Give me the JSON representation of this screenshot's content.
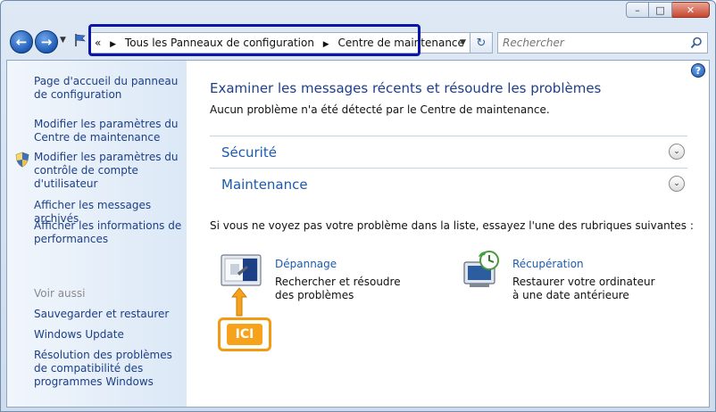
{
  "window": {
    "caption": {
      "minimize": "–",
      "maximize": "□",
      "close": "✕"
    }
  },
  "nav": {
    "back_glyph": "←",
    "forward_glyph": "→",
    "dropdown_glyph": "▼",
    "breadcrumb_prefix": "«",
    "breadcrumb": [
      "Tous les Panneaux de configuration",
      "Centre de maintenance"
    ],
    "breadcrumb_sep": "▶",
    "refresh_glyph": "↻",
    "search_placeholder": "Rechercher"
  },
  "sidebar": {
    "links": [
      "Page d'accueil du panneau de configuration",
      "Modifier les paramètres du Centre de maintenance",
      "Modifier les paramètres du contrôle de compte d'utilisateur",
      "Afficher les messages archivés",
      "Afficher les informations de performances"
    ],
    "see_also_label": "Voir aussi",
    "see_also": [
      "Sauvegarder et restaurer",
      "Windows Update",
      "Résolution des problèmes de compatibilité des programmes Windows"
    ]
  },
  "main": {
    "help_glyph": "?",
    "title": "Examiner les messages récents et résoudre les problèmes",
    "subtitle": "Aucun problème n'a été détecté par le Centre de maintenance.",
    "sections": [
      {
        "label": "Sécurité"
      },
      {
        "label": "Maintenance"
      }
    ],
    "chevron_glyph": "⌄",
    "hint": "Si vous ne voyez pas votre problème dans la liste, essayez l'une des rubriques suivantes :",
    "tools": [
      {
        "title": "Dépannage",
        "description": "Rechercher et résoudre des problèmes",
        "icon": "troubleshooting-icon"
      },
      {
        "title": "Récupération",
        "description": "Restaurer votre ordinateur à une date antérieure",
        "icon": "recovery-icon"
      }
    ]
  },
  "annotation": {
    "label": "ICI",
    "color": "#f29a14"
  },
  "colors": {
    "link": "#1d3f86",
    "heading": "#1e3f8a",
    "section": "#1c5bb0",
    "highlight_border": "#0a16a8"
  }
}
